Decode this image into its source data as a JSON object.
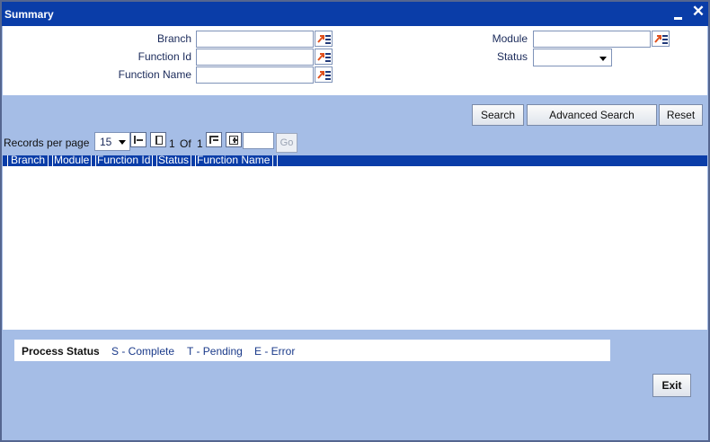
{
  "window": {
    "title": "Summary"
  },
  "form": {
    "branch_label": "Branch",
    "function_id_label": "Function Id",
    "function_name_label": "Function Name",
    "module_label": "Module",
    "status_label": "Status",
    "branch_value": "",
    "function_id_value": "",
    "function_name_value": "",
    "module_value": "",
    "status_value": ""
  },
  "buttons": {
    "search": "Search",
    "advanced_search": "Advanced Search",
    "reset": "Reset",
    "exit": "Exit",
    "go": "Go"
  },
  "pagination": {
    "records_label": "Records per page",
    "per_page": "15",
    "current_page": "1",
    "of_label": "Of",
    "total_pages": "1"
  },
  "grid": {
    "columns": [
      "Branch",
      "Module",
      "Function Id",
      "Status",
      "Function Name"
    ],
    "rows": []
  },
  "status_legend": {
    "title": "Process Status",
    "items": [
      "S - Complete",
      "T - Pending",
      "E - Error"
    ]
  },
  "colors": {
    "title_bar": "#0a3da8",
    "panel_bg": "#a5bde6",
    "label_text": "#1a2a5a",
    "lov_arrow": "#e0501c"
  }
}
